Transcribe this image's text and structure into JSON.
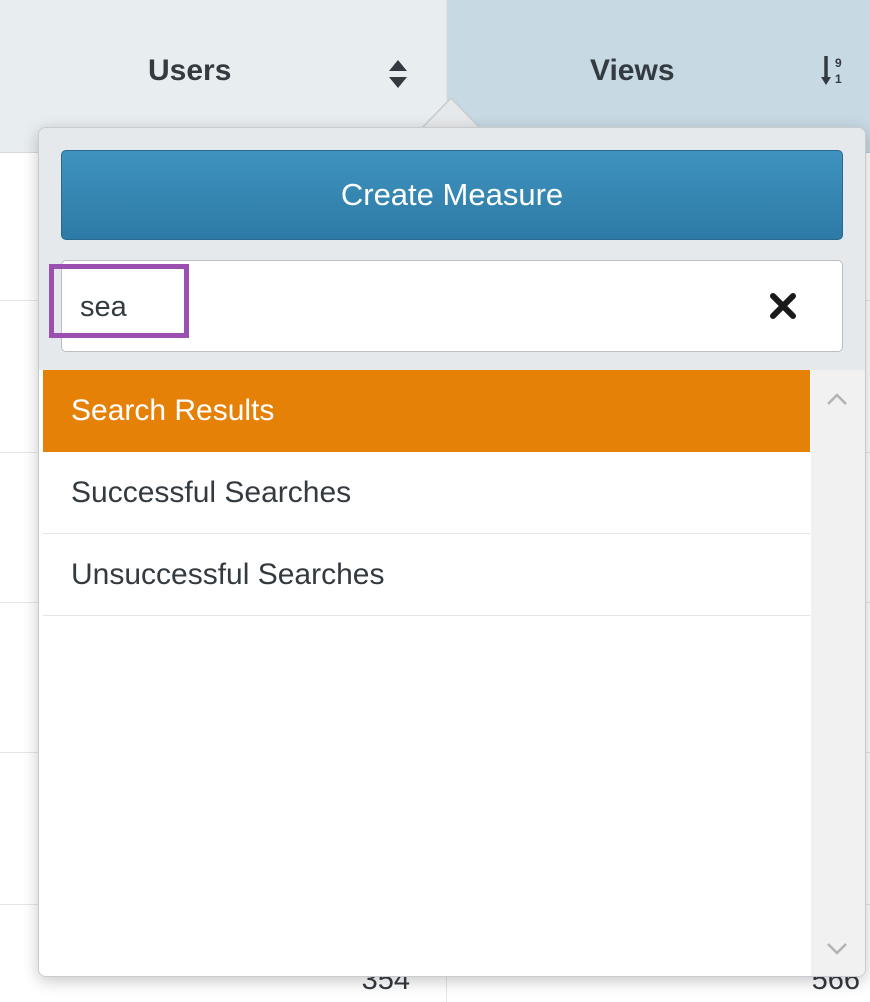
{
  "table": {
    "columns": [
      {
        "label": "Users",
        "sort_icon": "sort-both-icon"
      },
      {
        "label": "Views",
        "sort_icon": "sort-numeric-desc-icon"
      }
    ],
    "visible_row": {
      "users": "354",
      "views": "566"
    }
  },
  "measure_picker": {
    "create_button_label": "Create Measure",
    "search": {
      "value": "sea",
      "clear_icon": "close-icon"
    },
    "results": [
      {
        "label": "Search Results",
        "active": true
      },
      {
        "label": "Successful Searches",
        "active": false
      },
      {
        "label": "Unsuccessful Searches",
        "active": false
      }
    ],
    "highlight_color": "#9b4fb0",
    "accent_color": "#e68107",
    "button_color": "#3a8bb8"
  }
}
